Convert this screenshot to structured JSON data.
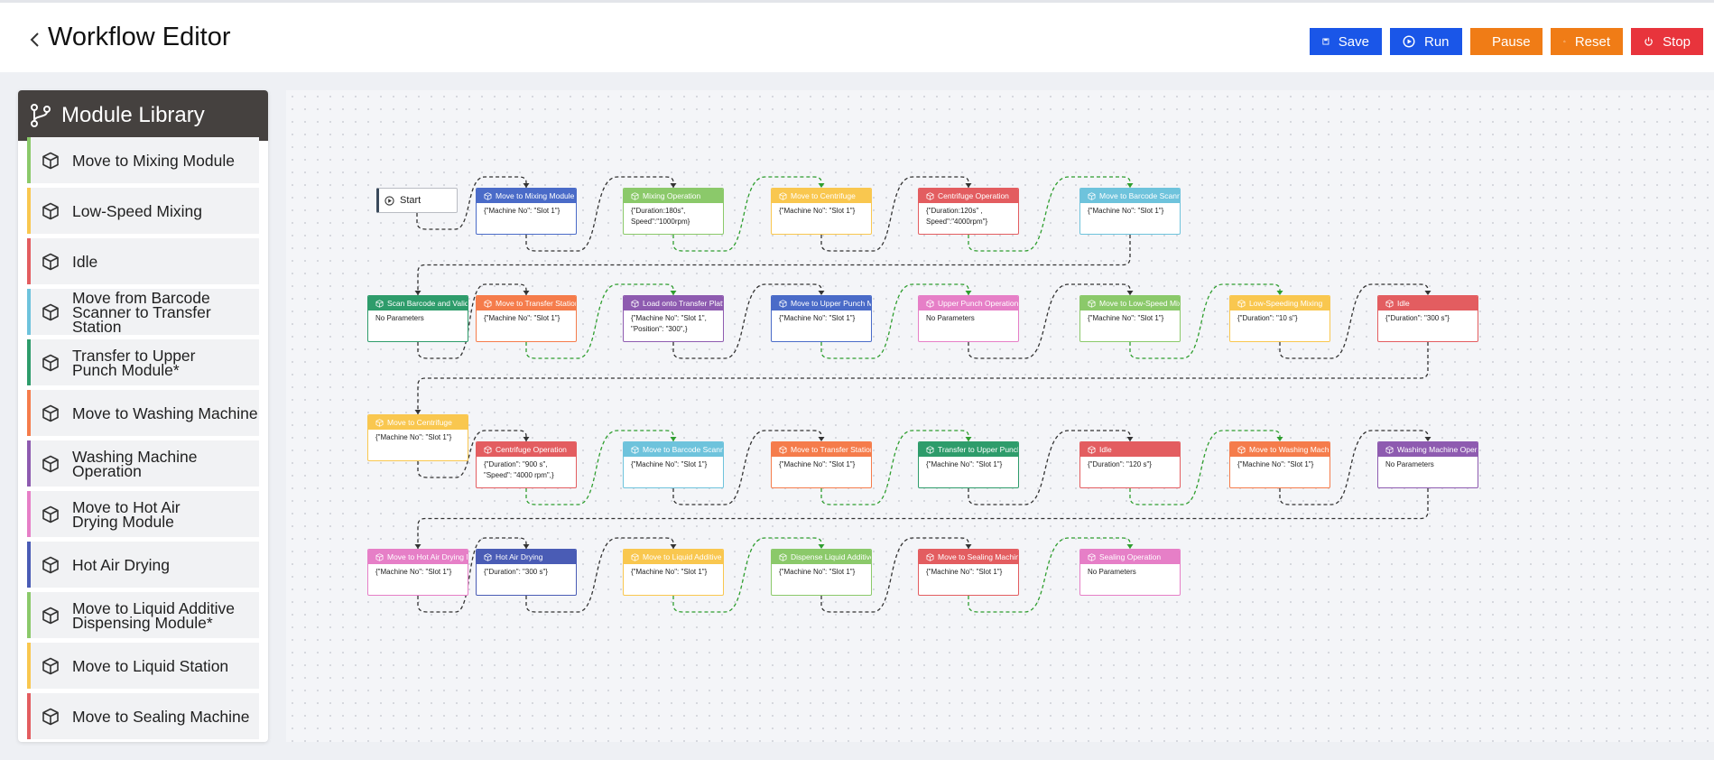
{
  "header": {
    "title": "Workflow Editor",
    "buttons": {
      "save": "Save",
      "run": "Run",
      "pause": "Pause",
      "reset": "Reset",
      "stop": "Stop"
    }
  },
  "library": {
    "title": "Module Library",
    "items": [
      {
        "label": "Move to Mixing Module",
        "color": "#8bc96a"
      },
      {
        "label": "Low-Speed Mixing",
        "color": "#f9c74f"
      },
      {
        "label": "Idle",
        "color": "#e35d60"
      },
      {
        "label": "Move from Barcode\nScanner to Transfer Station",
        "color": "#6ec3dc"
      },
      {
        "label": "Transfer to Upper\nPunch Module*",
        "color": "#2e9c6b"
      },
      {
        "label": "Move to Washing Machine",
        "color": "#f57c4b"
      },
      {
        "label": "Washing Machine Operation",
        "color": "#8e5bb0"
      },
      {
        "label": "Move to Hot Air\nDrying Module",
        "color": "#e67fc7"
      },
      {
        "label": "Hot Air Drying",
        "color": "#4a5cb5"
      },
      {
        "label": "Move to Liquid Additive\nDispensing Module*",
        "color": "#8bc96a"
      },
      {
        "label": "Move to Liquid Station",
        "color": "#f9c74f"
      },
      {
        "label": "Move to Sealing Machine",
        "color": "#e35d60"
      }
    ]
  },
  "canvas": {
    "start_label": "Start",
    "nodes": [
      {
        "title": "Move to Mixing Module",
        "params": "{\"Machine No\": \"Slot 1\"}",
        "color": "#4a6bc8"
      },
      {
        "title": "Mixing Operation",
        "params": "{\"Duration:180s\",\n Speed\":\"1000rpm}",
        "color": "#8bc96a"
      },
      {
        "title": "Move to Centrifuge",
        "params": "{\"Machine No\": \"Slot 1\"}",
        "color": "#f9c74f"
      },
      {
        "title": "Centrifuge Operation",
        "params": "{\"Duration:120s\" ,\n Speed\":\"4000rpm\"}",
        "color": "#e35d60"
      },
      {
        "title": "Move to Barcode Scanner",
        "params": "{\"Machine No\": \"Slot 1\"}",
        "color": "#6ec3dc"
      },
      {
        "title": "Scan Barcode and Validate",
        "params": "No Parameters",
        "color": "#2e9c6b"
      },
      {
        "title": "Move to Transfer Station",
        "params": "{\"Machine No\": \"Slot 1\"}",
        "color": "#f57c4b"
      },
      {
        "title": "Load onto Transfer Platform",
        "params": "{\"Machine No\": \"Slot 1\",\n \"Position\": \"300\",}",
        "color": "#8e5bb0"
      },
      {
        "title": "Move to Upper Punch Module",
        "params": "{\"Machine No\": \"Slot 1\"}",
        "color": "#4a6bc8"
      },
      {
        "title": "Upper Punch Operation",
        "params": "No Parameters",
        "color": "#e67fc7"
      },
      {
        "title": "Move to Low-Speed Mixing",
        "params": "{\"Machine No\": \"Slot 1\"}",
        "color": "#8bc96a"
      },
      {
        "title": "Low-Speeding Mixing",
        "params": "{\"Duration\": \"10 s\"}",
        "color": "#f9c74f"
      },
      {
        "title": "Idle",
        "params": "{\"Duration\": \"300 s\"}",
        "color": "#e35d60"
      },
      {
        "title": "Move to Centrifuge",
        "params": "{\"Machine No\": \"Slot 1\"}",
        "color": "#f9c74f"
      },
      {
        "title": "Centrifuge Operation",
        "params": "{\"Duration\": \"900 s\",\n \"Speed\": \"4000 rpm\",}",
        "color": "#e35d60"
      },
      {
        "title": "Move to Barcode Scanner",
        "params": "{\"Machine No\": \"Slot 1\"}",
        "color": "#6ec3dc"
      },
      {
        "title": "Move to Transfer Station",
        "params": "{\"Machine No\": \"Slot 1\"}",
        "color": "#f57c4b"
      },
      {
        "title": "Transfer to Upper Punch Module",
        "params": "{\"Machine No\": \"Slot 1\"}",
        "color": "#2e9c6b"
      },
      {
        "title": "Idle",
        "params": "{\"Duration\": \"120 s\"}",
        "color": "#e35d60"
      },
      {
        "title": "Move to Washing Machine",
        "params": "{\"Machine No\": \"Slot 1\"}",
        "color": "#f57c4b"
      },
      {
        "title": "Washing Machine Operation",
        "params": "No Parameters",
        "color": "#8e5bb0"
      },
      {
        "title": "Move to Hot Air Drying Module",
        "params": "{\"Machine No\": \"Slot 1\"}",
        "color": "#e67fc7"
      },
      {
        "title": "Hot Air Drying",
        "params": "{\"Duration\": \"300 s\"}",
        "color": "#4a5cb5"
      },
      {
        "title": "Move to Liquid Additive",
        "params": "{\"Machine No\": \"Slot 1\"}",
        "color": "#f9c74f"
      },
      {
        "title": "Dispense Liquid Additive",
        "params": "{\"Machine No\": \"Slot 1\"}",
        "color": "#8bc96a"
      },
      {
        "title": "Move to Sealing Machine",
        "params": "{\"Machine No\": \"Slot 1\"}",
        "color": "#e35d60"
      },
      {
        "title": "Sealing Operation",
        "params": "No Parameters",
        "color": "#e67fc7"
      }
    ]
  }
}
